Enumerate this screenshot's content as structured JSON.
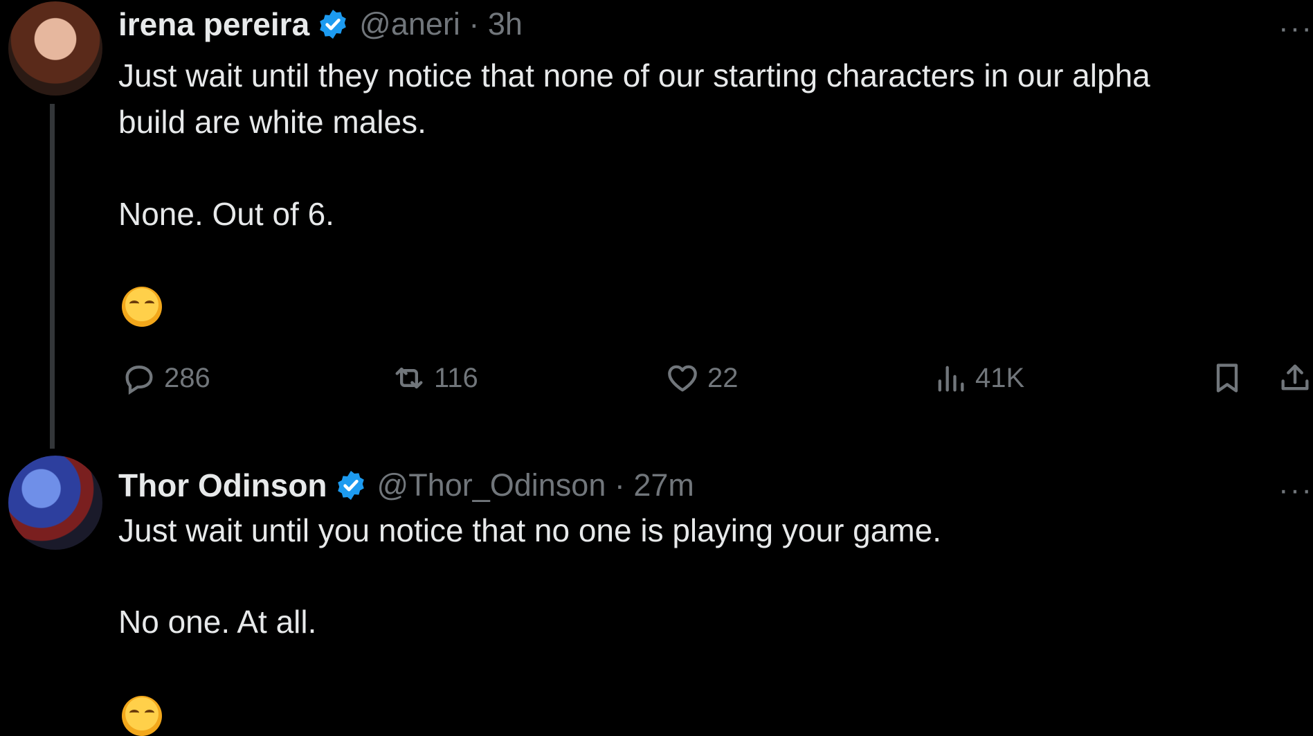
{
  "tweets": [
    {
      "author_name": "irena pereira",
      "handle": "@aneri · 3h",
      "more": "···",
      "line1": "Just wait until they notice that none of our starting characters in our alpha",
      "line2": "build are white males.",
      "line3": "None. Out of 6.",
      "emoji": "😊",
      "actions": {
        "replies": "286",
        "reposts": "116",
        "likes": "22",
        "views": "41K"
      },
      "icons": [
        "reply-icon",
        "repost-icon",
        "like-icon",
        "views-icon",
        "bookmark-icon",
        "share-icon"
      ]
    },
    {
      "author_name": "Thor Odinson",
      "handle": "@Thor_Odinson · 27m",
      "more": "···",
      "line1": "Just wait until you notice that no one is playing your game.",
      "line2": "No one. At all.",
      "emoji": "😊"
    }
  ],
  "colors": {
    "background": "#000000",
    "text": "#e7e9ea",
    "muted": "#71767b",
    "verified": "#1d9bf0",
    "thread_line": "#333639"
  }
}
